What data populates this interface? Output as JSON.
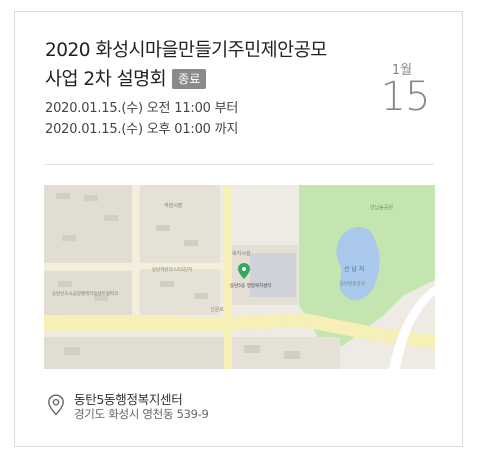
{
  "event": {
    "title": "2020 화성시마을만들기주민제안공모 사업 2차 설명회",
    "status_badge": "종료",
    "start_time": "2020.01.15.(수) 오전 11:00 부터",
    "end_time": "2020.01.15.(수) 오후 01:00 까지",
    "date_month": "1월",
    "date_day": "15"
  },
  "map": {
    "labels": {
      "school": "석원시장",
      "apt_left": "동탄신도시금강펜테리움센트럴파크",
      "apt_mid": "동탄역린더스트5단지",
      "welfare_area": "복지시설",
      "marker_label": "동탄5동\n행정복지센터",
      "park": "선납숲공원",
      "lake": "선 납 지",
      "lake_sub": "동탄반송공원",
      "road": "신원로"
    },
    "colors": {
      "land": "#eeebe4",
      "road": "#f6efb7",
      "park": "#c4e5b0",
      "water": "#a9c8ec",
      "block": "#e2ddd2",
      "building": "#d3cec4",
      "marker": "#2fa95d"
    }
  },
  "location": {
    "name": "동탄5동행정복지센터",
    "address": "경기도 화성시 영천동 539-9",
    "icon": "location-pin-icon"
  }
}
